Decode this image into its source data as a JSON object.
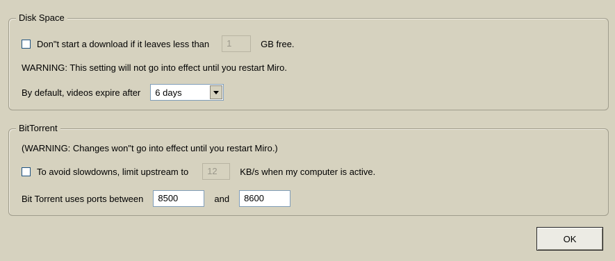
{
  "disk_space": {
    "title": "Disk Space",
    "min_free_label": "Don\"t start a download if it leaves less than",
    "min_free_value": "1",
    "min_free_unit": "GB free.",
    "warning": "WARNING: This setting will not go into effect until you restart Miro.",
    "expire_label": "By default, videos expire after",
    "expire_value": "6 days"
  },
  "bittorrent": {
    "title": "BitTorrent",
    "warning": "(WARNING: Changes won\"t go into effect until you restart Miro.)",
    "limit_label": "To avoid slowdowns, limit upstream to",
    "limit_value": "12",
    "limit_unit": "KB/s when my computer is active.",
    "ports_label": "Bit Torrent uses ports between",
    "port_min": "8500",
    "ports_and": "and",
    "port_max": "8600"
  },
  "footer": {
    "ok_label": "OK"
  }
}
